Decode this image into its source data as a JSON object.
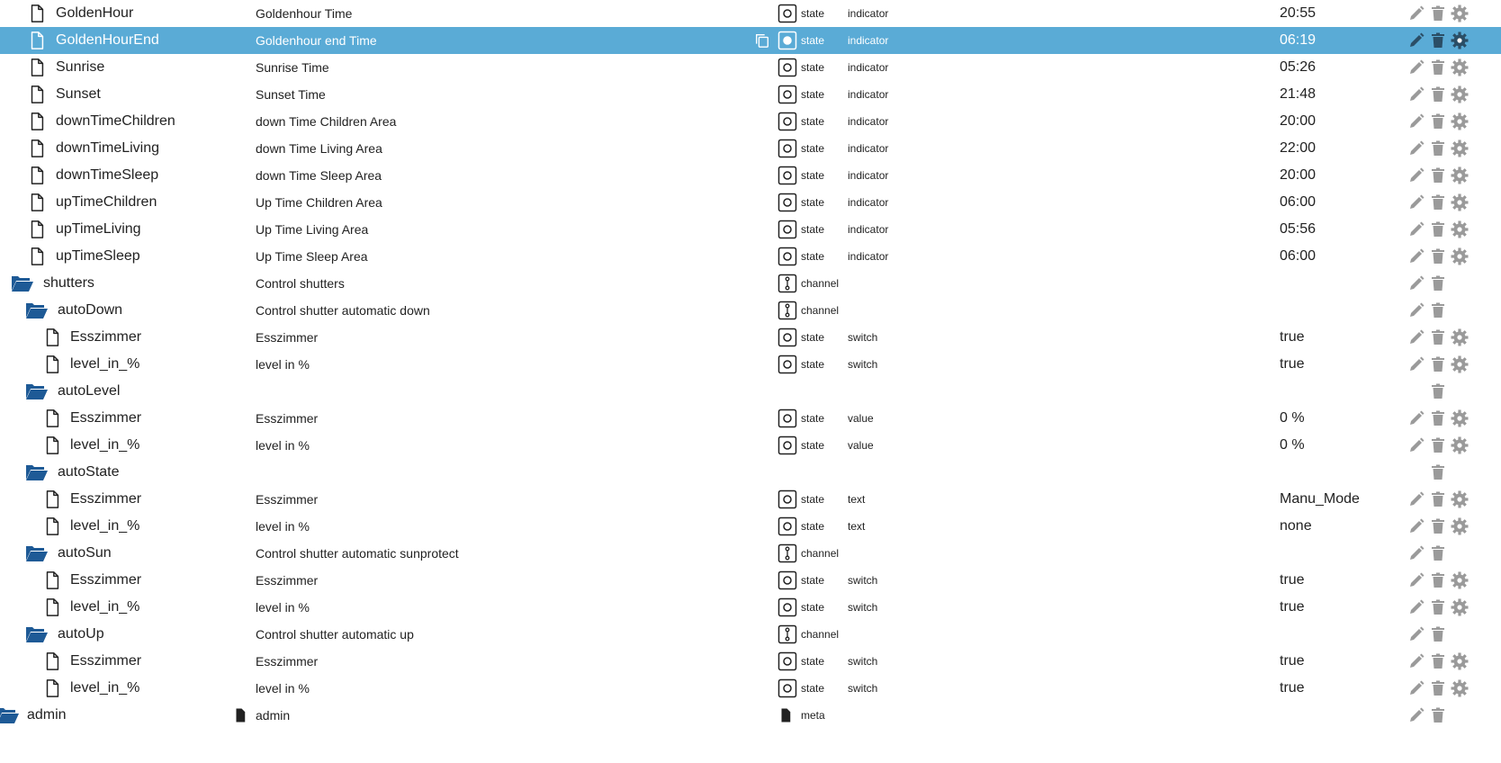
{
  "colors": {
    "selected_bg": "#5aabd6",
    "folder": "#1e5a96",
    "action_icon": "#9a9a9a",
    "text": "#222222"
  },
  "rows": [
    {
      "name": "GoldenHour",
      "desc": "Goldenhour Time",
      "type": "state",
      "role": "indicator",
      "value": "20:55",
      "icon": "file",
      "level": 0,
      "actions": [
        "edit",
        "delete",
        "settings"
      ]
    },
    {
      "name": "GoldenHourEnd",
      "desc": "Goldenhour end Time",
      "type": "state",
      "role": "indicator",
      "value": "06:19",
      "icon": "file",
      "level": 0,
      "selected": true,
      "copy": true,
      "actions": [
        "edit",
        "delete",
        "settings"
      ]
    },
    {
      "name": "Sunrise",
      "desc": "Sunrise Time",
      "type": "state",
      "role": "indicator",
      "value": "05:26",
      "icon": "file",
      "level": 0,
      "actions": [
        "edit",
        "delete",
        "settings"
      ]
    },
    {
      "name": "Sunset",
      "desc": "Sunset Time",
      "type": "state",
      "role": "indicator",
      "value": "21:48",
      "icon": "file",
      "level": 0,
      "actions": [
        "edit",
        "delete",
        "settings"
      ]
    },
    {
      "name": "downTimeChildren",
      "desc": "down Time Children Area",
      "type": "state",
      "role": "indicator",
      "value": "20:00",
      "icon": "file",
      "level": 0,
      "actions": [
        "edit",
        "delete",
        "settings"
      ]
    },
    {
      "name": "downTimeLiving",
      "desc": "down Time Living Area",
      "type": "state",
      "role": "indicator",
      "value": "22:00",
      "icon": "file",
      "level": 0,
      "actions": [
        "edit",
        "delete",
        "settings"
      ]
    },
    {
      "name": "downTimeSleep",
      "desc": "down Time Sleep Area",
      "type": "state",
      "role": "indicator",
      "value": "20:00",
      "icon": "file",
      "level": 0,
      "actions": [
        "edit",
        "delete",
        "settings"
      ]
    },
    {
      "name": "upTimeChildren",
      "desc": "Up Time Children Area",
      "type": "state",
      "role": "indicator",
      "value": "06:00",
      "icon": "file",
      "level": 0,
      "actions": [
        "edit",
        "delete",
        "settings"
      ]
    },
    {
      "name": "upTimeLiving",
      "desc": "Up Time Living Area",
      "type": "state",
      "role": "indicator",
      "value": "05:56",
      "icon": "file",
      "level": 0,
      "actions": [
        "edit",
        "delete",
        "settings"
      ]
    },
    {
      "name": "upTimeSleep",
      "desc": "Up Time Sleep Area",
      "type": "state",
      "role": "indicator",
      "value": "06:00",
      "icon": "file",
      "level": 0,
      "actions": [
        "edit",
        "delete",
        "settings"
      ]
    },
    {
      "name": "shutters",
      "desc": "Control shutters",
      "type": "channel",
      "role": "",
      "value": "",
      "icon": "folder",
      "level": -1,
      "actions": [
        "edit",
        "delete"
      ]
    },
    {
      "name": "autoDown",
      "desc": "Control shutter automatic down",
      "type": "channel",
      "role": "",
      "value": "",
      "icon": "folder",
      "level": 1,
      "actions": [
        "edit",
        "delete"
      ]
    },
    {
      "name": "Esszimmer",
      "desc": "Esszimmer",
      "type": "state",
      "role": "switch",
      "value": "true",
      "icon": "file",
      "level": 2,
      "actions": [
        "edit",
        "delete",
        "settings"
      ]
    },
    {
      "name": "level_in_%",
      "desc": "level in %",
      "type": "state",
      "role": "switch",
      "value": "true",
      "icon": "file",
      "level": 2,
      "actions": [
        "edit",
        "delete",
        "settings"
      ]
    },
    {
      "name": "autoLevel",
      "desc": "",
      "type": "",
      "role": "",
      "value": "",
      "icon": "folder",
      "level": 1,
      "actions": [
        "delete"
      ]
    },
    {
      "name": "Esszimmer",
      "desc": "Esszimmer",
      "type": "state",
      "role": "value",
      "value": "0 %",
      "icon": "file",
      "level": 2,
      "actions": [
        "edit",
        "delete",
        "settings"
      ]
    },
    {
      "name": "level_in_%",
      "desc": "level in %",
      "type": "state",
      "role": "value",
      "value": "0 %",
      "icon": "file",
      "level": 2,
      "actions": [
        "edit",
        "delete",
        "settings"
      ]
    },
    {
      "name": "autoState",
      "desc": "",
      "type": "",
      "role": "",
      "value": "",
      "icon": "folder",
      "level": 1,
      "actions": [
        "delete"
      ]
    },
    {
      "name": "Esszimmer",
      "desc": "Esszimmer",
      "type": "state",
      "role": "text",
      "value": "Manu_Mode",
      "icon": "file",
      "level": 2,
      "actions": [
        "edit",
        "delete",
        "settings"
      ]
    },
    {
      "name": "level_in_%",
      "desc": "level in %",
      "type": "state",
      "role": "text",
      "value": "none",
      "icon": "file",
      "level": 2,
      "actions": [
        "edit",
        "delete",
        "settings"
      ]
    },
    {
      "name": "autoSun",
      "desc": "Control shutter automatic sunprotect",
      "type": "channel",
      "role": "",
      "value": "",
      "icon": "folder",
      "level": 1,
      "actions": [
        "edit",
        "delete"
      ]
    },
    {
      "name": "Esszimmer",
      "desc": "Esszimmer",
      "type": "state",
      "role": "switch",
      "value": "true",
      "icon": "file",
      "level": 2,
      "actions": [
        "edit",
        "delete",
        "settings"
      ]
    },
    {
      "name": "level_in_%",
      "desc": "level in %",
      "type": "state",
      "role": "switch",
      "value": "true",
      "icon": "file",
      "level": 2,
      "actions": [
        "edit",
        "delete",
        "settings"
      ]
    },
    {
      "name": "autoUp",
      "desc": "Control shutter automatic up",
      "type": "channel",
      "role": "",
      "value": "",
      "icon": "folder",
      "level": 1,
      "actions": [
        "edit",
        "delete"
      ]
    },
    {
      "name": "Esszimmer",
      "desc": "Esszimmer",
      "type": "state",
      "role": "switch",
      "value": "true",
      "icon": "file",
      "level": 2,
      "actions": [
        "edit",
        "delete",
        "settings"
      ]
    },
    {
      "name": "level_in_%",
      "desc": "level in %",
      "type": "state",
      "role": "switch",
      "value": "true",
      "icon": "file",
      "level": 2,
      "actions": [
        "edit",
        "delete",
        "settings"
      ]
    },
    {
      "name": "admin",
      "desc": "admin",
      "type": "meta",
      "role": "",
      "value": "",
      "icon": "folder",
      "level": -2,
      "desc_icon": "file",
      "type_icon": "file",
      "actions": [
        "edit",
        "delete"
      ]
    }
  ]
}
